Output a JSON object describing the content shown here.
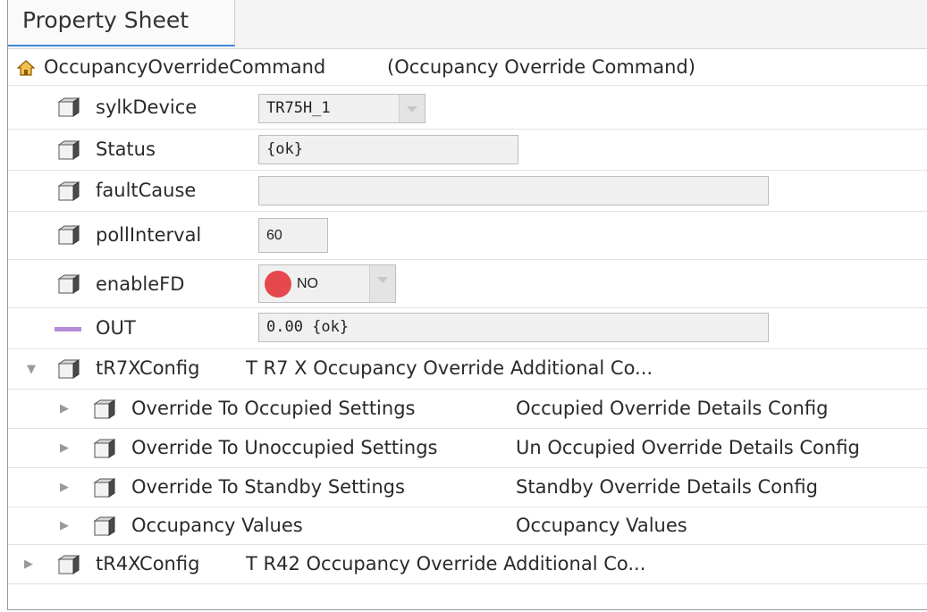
{
  "tab": {
    "label": "Property Sheet"
  },
  "root": {
    "name": "OccupancyOverrideCommand",
    "display": "(Occupancy Override Command)"
  },
  "properties": {
    "sylkDevice": {
      "label": "sylkDevice",
      "value": "TR75H_1"
    },
    "status": {
      "label": "Status",
      "value": "{ok}"
    },
    "faultCause": {
      "label": "faultCause",
      "value": ""
    },
    "pollInterval": {
      "label": "pollInterval",
      "value": "60"
    },
    "enableFD": {
      "label": "enableFD",
      "value": "NO",
      "indicator_color": "#e5484d"
    },
    "out": {
      "label": "OUT",
      "value": "0.00 {ok}",
      "slot_color": "#b68bd8"
    }
  },
  "tr7x": {
    "label": "tR7XConfig",
    "display": "T R7 X Occupancy Override Additional Co...",
    "children": [
      {
        "label": "Override To Occupied Settings",
        "value": "Occupied Override Details Config"
      },
      {
        "label": "Override To Unoccupied Settings",
        "value": "Un Occupied Override Details Config"
      },
      {
        "label": "Override To Standby Settings",
        "value": "Standby Override Details Config"
      },
      {
        "label": "Occupancy Values",
        "value": "Occupancy Values"
      }
    ]
  },
  "tr4x": {
    "label": "tR4XConfig",
    "display": "T R42 Occupancy Override Additional Co..."
  },
  "colors": {
    "tab_accent": "#3d86d6",
    "indicator": "#e5484d",
    "out_slot": "#b68bd8"
  }
}
